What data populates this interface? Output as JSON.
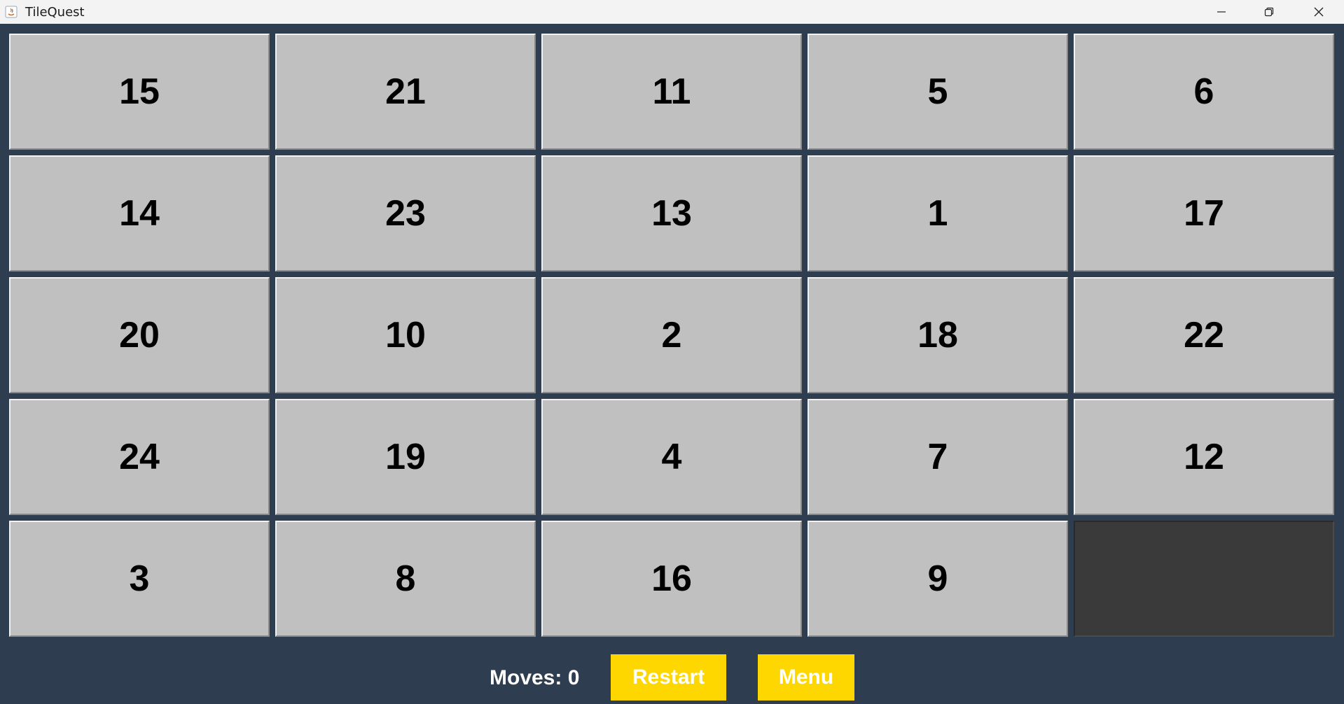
{
  "window": {
    "title": "TileQuest"
  },
  "board": {
    "tiles": [
      [
        "15",
        "21",
        "11",
        "5",
        "6"
      ],
      [
        "14",
        "23",
        "13",
        "1",
        "17"
      ],
      [
        "20",
        "10",
        "2",
        "18",
        "22"
      ],
      [
        "24",
        "19",
        "4",
        "7",
        "12"
      ],
      [
        "3",
        "8",
        "16",
        "9",
        ""
      ]
    ],
    "empty_position": {
      "row": 4,
      "col": 4
    }
  },
  "footer": {
    "moves_text": "Moves: 0",
    "restart_label": "Restart",
    "menu_label": "Menu"
  },
  "colors": {
    "background": "#2e3d4f",
    "tile": "#c0c0c0",
    "empty_tile": "#3a3a3a",
    "button": "#ffd700",
    "button_text": "#ffffff"
  }
}
